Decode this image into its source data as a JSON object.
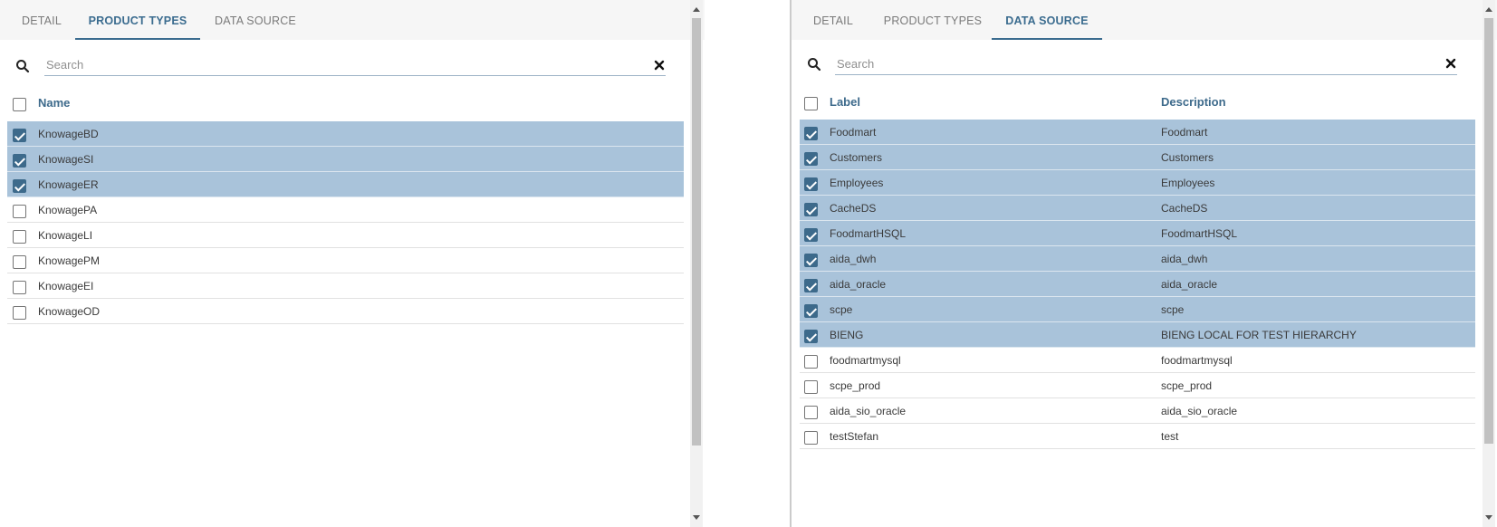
{
  "left": {
    "tabs": [
      {
        "label": "DETAIL",
        "active": false
      },
      {
        "label": "PRODUCT TYPES",
        "active": true
      },
      {
        "label": "DATA SOURCE",
        "active": false
      }
    ],
    "search": {
      "placeholder": "Search",
      "value": ""
    },
    "columns": [
      "Name"
    ],
    "rows": [
      {
        "name": "KnowageBD",
        "checked": true
      },
      {
        "name": "KnowageSI",
        "checked": true
      },
      {
        "name": "KnowageER",
        "checked": true
      },
      {
        "name": "KnowagePA",
        "checked": false
      },
      {
        "name": "KnowageLI",
        "checked": false
      },
      {
        "name": "KnowagePM",
        "checked": false
      },
      {
        "name": "KnowageEI",
        "checked": false
      },
      {
        "name": "KnowageOD",
        "checked": false
      }
    ]
  },
  "right": {
    "tabs": [
      {
        "label": "DETAIL",
        "active": false
      },
      {
        "label": "PRODUCT TYPES",
        "active": false
      },
      {
        "label": "DATA SOURCE",
        "active": true
      }
    ],
    "search": {
      "placeholder": "Search",
      "value": ""
    },
    "columns": [
      "Label",
      "Description"
    ],
    "rows": [
      {
        "label": "Foodmart",
        "description": "Foodmart",
        "checked": true
      },
      {
        "label": "Customers",
        "description": "Customers",
        "checked": true
      },
      {
        "label": "Employees",
        "description": "Employees",
        "checked": true
      },
      {
        "label": "CacheDS",
        "description": "CacheDS",
        "checked": true
      },
      {
        "label": "FoodmartHSQL",
        "description": "FoodmartHSQL",
        "checked": true
      },
      {
        "label": "aida_dwh",
        "description": "aida_dwh",
        "checked": true
      },
      {
        "label": "aida_oracle",
        "description": "aida_oracle",
        "checked": true
      },
      {
        "label": "scpe",
        "description": "scpe",
        "checked": true
      },
      {
        "label": "BIENG",
        "description": "BIENG LOCAL FOR TEST HIERARCHY",
        "checked": true
      },
      {
        "label": "foodmartmysql",
        "description": "foodmartmysql",
        "checked": false
      },
      {
        "label": "scpe_prod",
        "description": "scpe_prod",
        "checked": false
      },
      {
        "label": "aida_sio_oracle",
        "description": "aida_sio_oracle",
        "checked": false
      },
      {
        "label": "testStefan",
        "description": "test",
        "checked": false
      }
    ]
  },
  "icons": {
    "search": "search-icon",
    "clear": "close-icon",
    "scroll_up": "arrow-up-icon",
    "scroll_down": "arrow-down-icon"
  },
  "colors": {
    "accent": "#3d6a8b",
    "selected_row": "#a9c3da",
    "tabbar": "#f6f6f6"
  }
}
